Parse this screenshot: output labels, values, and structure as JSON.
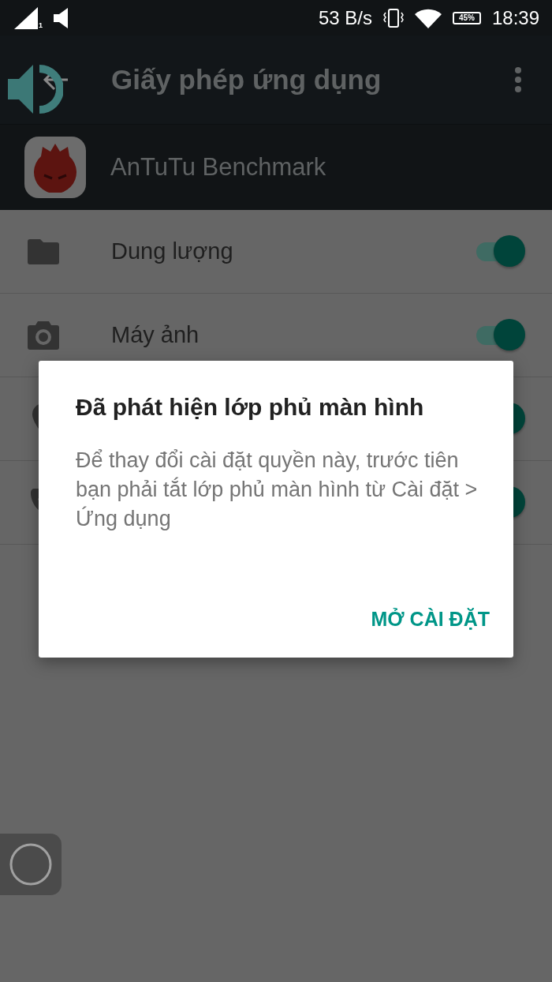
{
  "status_bar": {
    "signal_label": "1",
    "speed": "53 B/s",
    "battery": "45%",
    "time": "18:39"
  },
  "toolbar": {
    "title": "Giấy phép ứng dụng"
  },
  "app": {
    "name": "AnTuTu Benchmark"
  },
  "permissions": [
    {
      "kind": "folder",
      "label": "Dung lượng",
      "on": true
    },
    {
      "kind": "camera",
      "label": "Máy ảnh",
      "on": true
    },
    {
      "kind": "pin",
      "on": true
    },
    {
      "kind": "phone",
      "on": true
    }
  ],
  "dialog": {
    "title": "Đã phát hiện lớp phủ màn hình",
    "message": "Để thay đổi cài đặt quyền này, trước tiên bạn phải tắt lớp phủ màn hình từ Cài đặt > Ứng dụng",
    "button": "MỞ CÀI ĐẶT"
  }
}
